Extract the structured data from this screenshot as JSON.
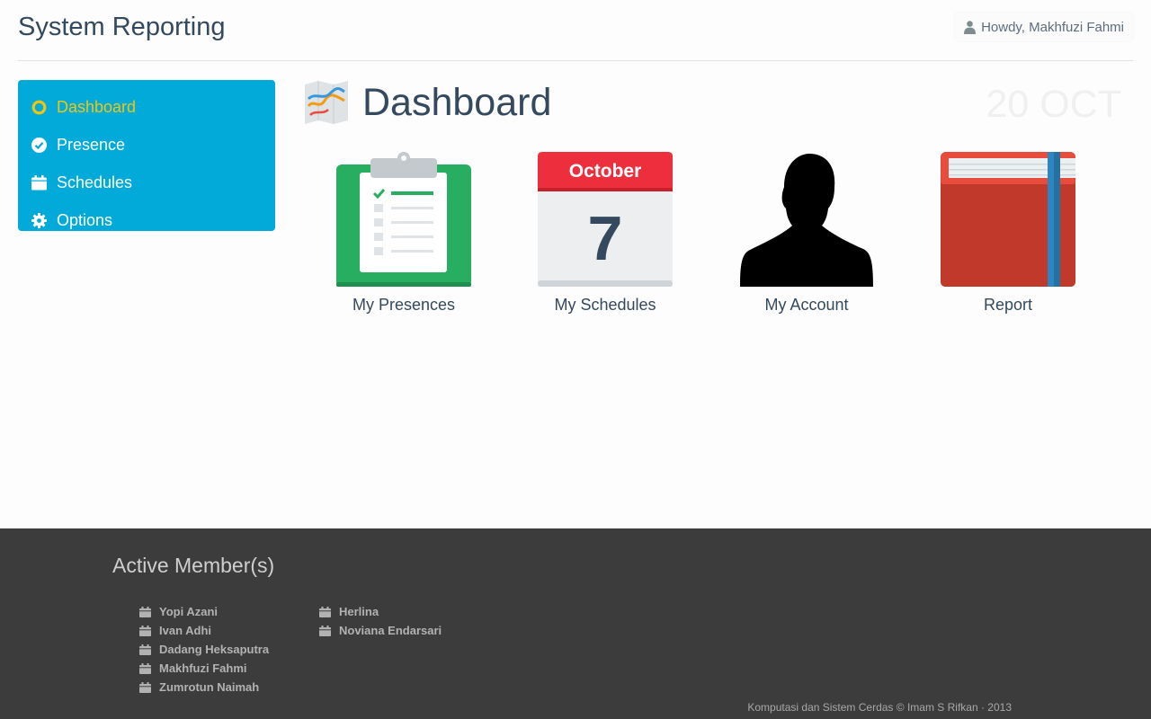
{
  "header": {
    "title": "System Reporting",
    "greeting": "Howdy, Makhfuzi Fahmi"
  },
  "sidebar": {
    "items": [
      {
        "label": "Dashboard",
        "icon": "ring-icon",
        "active": true
      },
      {
        "label": "Presence",
        "icon": "check-circle-icon",
        "active": false
      },
      {
        "label": "Schedules",
        "icon": "calendar-icon",
        "active": false
      },
      {
        "label": "Options",
        "icon": "gear-icon",
        "active": false
      }
    ]
  },
  "main": {
    "title": "Dashboard",
    "date": "20 OCT",
    "tiles": [
      {
        "label": "My Presences",
        "icon": "clipboard-icon"
      },
      {
        "label": "My Schedules",
        "icon": "calendar-page-icon",
        "month": "October",
        "day": "7"
      },
      {
        "label": "My Account",
        "icon": "person-silhouette-icon"
      },
      {
        "label": "Report",
        "icon": "book-icon"
      }
    ]
  },
  "footer": {
    "title": "Active Member(s)",
    "members_col1": [
      "Yopi Azani",
      "Ivan Adhi",
      "Dadang Heksaputra",
      "Makhfuzi Fahmi",
      "Zumrotun Naimah"
    ],
    "members_col2": [
      "Herlina",
      "Noviana Endarsari"
    ],
    "credit": "Komputasi dan Sistem Cerdas © Imam S Rifkan · 2013"
  },
  "colors": {
    "sidebar_bg": "#02aad9",
    "active_accent": "#f1c40f",
    "footer_bg": "#3c3c3c",
    "text_dark": "#34495e"
  }
}
